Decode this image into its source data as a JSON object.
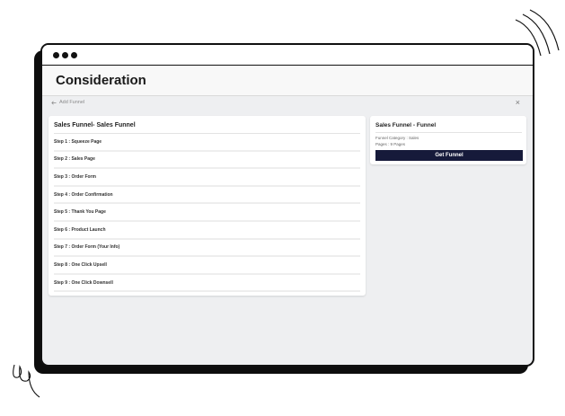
{
  "window": {
    "title": "Consideration"
  },
  "subbar": {
    "back_label": "Add Funnel",
    "close_symbol": "×"
  },
  "funnel": {
    "title": "Sales Funnel- Sales Funnel",
    "steps": [
      "Step 1 : Squeeze Page",
      "Step 2 : Sales Page",
      "Step 3 : Order Form",
      "Step 4 : Order Confirmation",
      "Step 5 : Thank You Page",
      "Step 6 : Product Launch",
      "Step 7 : Order Form (Your Info)",
      "Step 8 : One Click Upsell",
      "Step 9 : One Click Downsell"
    ]
  },
  "info": {
    "title": "Sales Funnel - Funnel",
    "category": "Funnel Category : Sales",
    "pages": "Pages : 9 Pages",
    "button_label": "Get Funnel"
  },
  "colors": {
    "button_bg": "#161a3a",
    "content_bg": "#eeeff1"
  }
}
